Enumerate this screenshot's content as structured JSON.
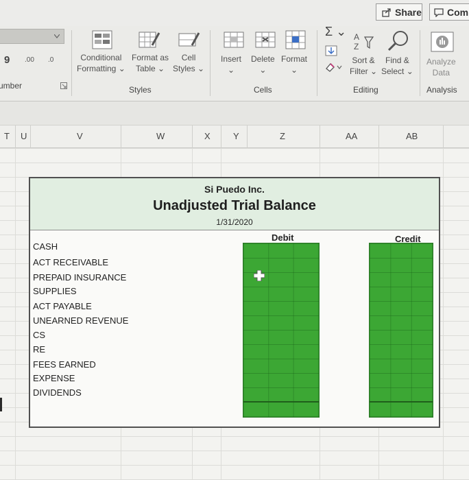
{
  "topbar": {
    "share_label": "Share",
    "comments_label": "Com"
  },
  "ribbon": {
    "number": {
      "group_label": "umber",
      "comma_glyph": "9",
      "inc_decimal": ".00",
      "dec_decimal": ".0"
    },
    "styles": {
      "group_label": "Styles",
      "conditional_line1": "Conditional",
      "conditional_line2": "Formatting",
      "format_table_line1": "Format as",
      "format_table_line2": "Table",
      "cell_styles_line1": "Cell",
      "cell_styles_line2": "Styles"
    },
    "cells": {
      "group_label": "Cells",
      "insert_label": "Insert",
      "delete_label": "Delete",
      "format_label": "Format"
    },
    "editing": {
      "group_label": "Editing",
      "sort_line1": "Sort &",
      "sort_line2": "Filter",
      "find_line1": "Find &",
      "find_line2": "Select"
    },
    "analysis": {
      "group_label": "Analysis",
      "analyze_line1": "Analyze",
      "analyze_line2": "Data"
    }
  },
  "columns": {
    "t": "T",
    "u": "U",
    "v": "V",
    "w": "W",
    "x": "X",
    "y": "Y",
    "z": "Z",
    "aa": "AA",
    "ab": "AB"
  },
  "trial_balance": {
    "company": "Si Puedo Inc.",
    "title": "Unadjusted Trial Balance",
    "date": "1/31/2020",
    "debit_header": "Debit",
    "credit_header": "Credit",
    "accounts": [
      "CASH",
      "ACT RECEIVABLE",
      "PREPAID INSURANCE",
      "SUPPLIES",
      "ACT PAYABLE",
      "UNEARNED REVENUE",
      "CS",
      "RE",
      "FEES EARNED",
      "EXPENSE",
      "DIVIDENDS"
    ],
    "input_fill_color": "#3ca734"
  }
}
